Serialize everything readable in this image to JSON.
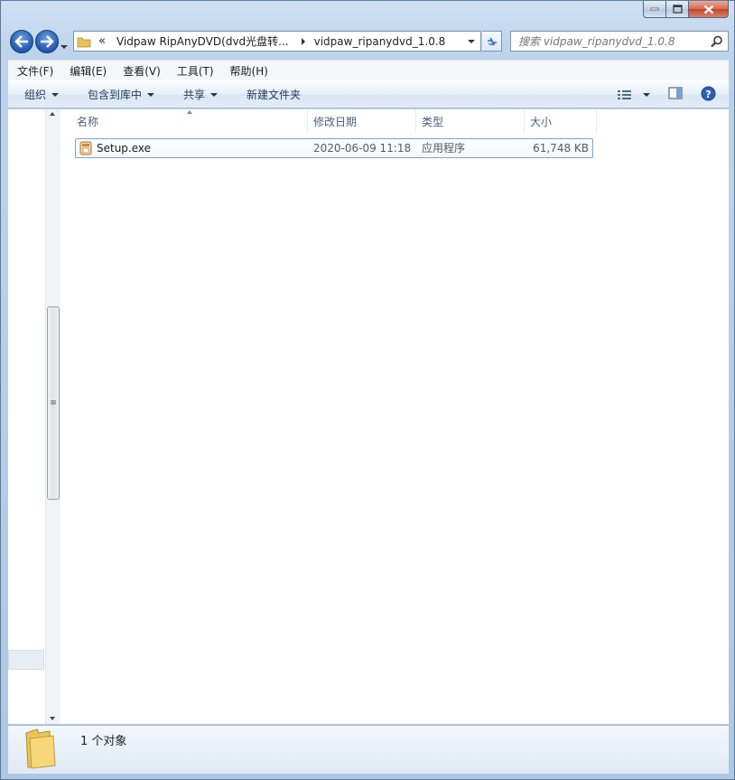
{
  "address": {
    "overflow_icon": "«",
    "crumb1": "Vidpaw RipAnyDVD(dvd光盘转...",
    "crumb2": "vidpaw_ripanydvd_1.0.8"
  },
  "search": {
    "placeholder": "搜索 vidpaw_ripanydvd_1.0.8"
  },
  "menu": [
    "文件(F)",
    "编辑(E)",
    "查看(V)",
    "工具(T)",
    "帮助(H)"
  ],
  "toolbar": {
    "organize": "组织",
    "include_library": "包含到库中",
    "share": "共享",
    "new_folder": "新建文件夹"
  },
  "columns": {
    "name": "名称",
    "date": "修改日期",
    "type": "类型",
    "size": "大小"
  },
  "files": [
    {
      "name": "Setup.exe",
      "date": "2020-06-09 11:18",
      "type": "应用程序",
      "size": "61,748 KB"
    }
  ],
  "status": {
    "count": "1 个对象"
  },
  "icons": {
    "back": "back-arrow-icon",
    "forward": "forward-arrow-icon",
    "folder": "folder-icon",
    "search": "search-icon",
    "help": "help-icon",
    "exe": "installer-icon"
  }
}
